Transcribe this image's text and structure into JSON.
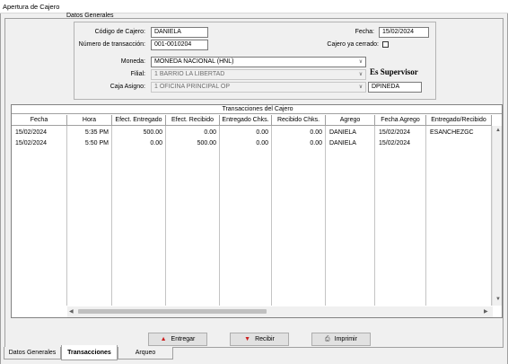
{
  "window": {
    "title": "Apertura de Cajero"
  },
  "general": {
    "legend": "Datos Generales",
    "codigo_label": "Código de Cajero:",
    "codigo_value": "DANIELA",
    "numero_label": "Número de transacción:",
    "numero_value": "001-0010204",
    "fecha_label": "Fecha:",
    "fecha_value": "15/02/2024",
    "cerrado_label": "Cajero ya cerrado:",
    "moneda_label": "Moneda:",
    "moneda_value": "MONEDA NACIONAL (HNL)",
    "filial_label": "Filial:",
    "filial_value": "1  BARRIO LA LIBERTAD",
    "caja_label": "Caja Asigno:",
    "caja_value": "1  OFICINA  PRINCIPAL OP",
    "supervisor_label": "Es Supervisor",
    "supervisor_value": "DPINEDA"
  },
  "grid": {
    "title": "Transacciones del Cajero",
    "headers": [
      "Fecha",
      "Hora",
      "Efect. Entregado",
      "Efect. Recibido",
      "Entregado Chks.",
      "Recibido Chks.",
      "Agrego",
      "Fecha Agrego",
      "Entregado/Recibido"
    ],
    "rows": [
      [
        "15/02/2024",
        "5:35 PM",
        "500.00",
        "0.00",
        "0.00",
        "0.00",
        "DANIELA",
        "15/02/2024",
        "ESANCHEZGC"
      ],
      [
        "15/02/2024",
        "5:50 PM",
        "0.00",
        "500.00",
        "0.00",
        "0.00",
        "DANIELA",
        "15/02/2024",
        ""
      ]
    ]
  },
  "buttons": {
    "entregar": "Entregar",
    "recibir": "Recibir",
    "imprimir": "Imprimir"
  },
  "tabs": [
    "Datos Generales",
    "Transacciones",
    "Arqueo"
  ],
  "colors": {
    "arrow_red": "#cc1f1f"
  }
}
